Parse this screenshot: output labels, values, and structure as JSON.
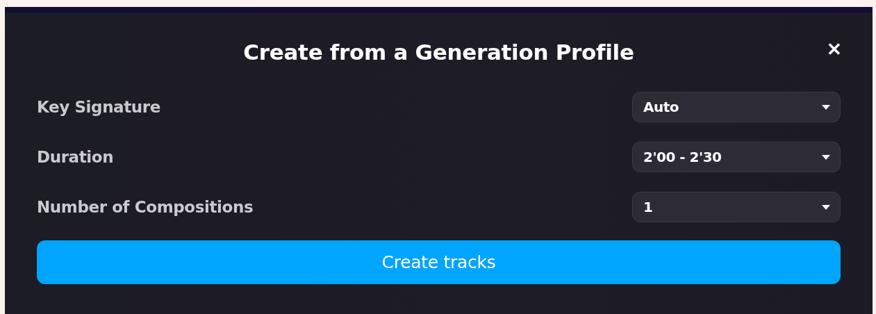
{
  "dialog": {
    "title": "Create from a Generation Profile",
    "close": "✕",
    "fields": [
      {
        "label": "Key Signature",
        "value": "Auto"
      },
      {
        "label": "Duration",
        "value": "2'00 - 2'30"
      },
      {
        "label": "Number of Compositions",
        "value": "1"
      }
    ],
    "submit": "Create tracks"
  }
}
